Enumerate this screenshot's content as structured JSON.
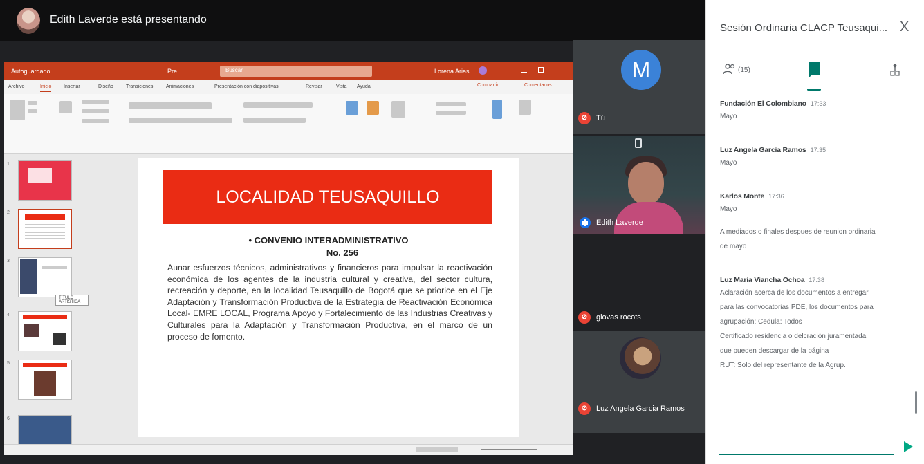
{
  "presenter": {
    "text": "Edith Laverde está presentando"
  },
  "ppt": {
    "autosave": "Autoguardado",
    "filename": "Pre...",
    "search_placeholder": "Buscar",
    "user": "Lorena Arias",
    "tabs": [
      "Archivo",
      "Inicio",
      "Insertar",
      "Diseño",
      "Transiciones",
      "Animaciones",
      "Presentación con diapositivas",
      "Revisar",
      "Vista",
      "Ayuda"
    ],
    "active_tab": "Inicio",
    "share": "Compartir",
    "comments": "Comentarios",
    "tooltip": "TÍTULO ARTÍSTICA",
    "slide": {
      "title": "LOCALIDAD TEUSAQUILLO",
      "subtitle1": "• CONVENIO INTERADMINISTRATIVO",
      "subtitle2": "No. 256",
      "body": "Aunar esfuerzos técnicos, administrativos y financieros para impulsar la reactivación económica de los agentes de la industria cultural y creativa, del sector cultura, recreación y deporte, en la localidad Teusaquillo de Bogotá que se priorice en el Eje Adaptación y Transformación Productiva de la Estrategia de Reactivación Económica Local- EMRE LOCAL, Programa Apoyo y Fortalecimiento de las Industrias Creativas y Culturales para la Adaptación y Transformación Productiva, en el marco de un proceso de fomento."
    },
    "thumb_numbers": [
      "1",
      "2",
      "3",
      "4",
      "5",
      "6"
    ]
  },
  "participants": {
    "me": {
      "initial": "M",
      "name": "Tú"
    },
    "edith": {
      "name": "Edith Laverde"
    },
    "giovas": {
      "name": "giovas rocots"
    },
    "luz": {
      "name": "Luz Angela Garcia Ramos"
    }
  },
  "panel": {
    "title": "Sesión Ordinaria CLACP Teusaqui...",
    "close": "X",
    "people_count": "(15)",
    "messages": [
      {
        "sender": "Fundación El Colombiano",
        "time": "17:33",
        "lines": [
          "Mayo"
        ]
      },
      {
        "sender": "Luz Angela Garcia Ramos",
        "time": "17:35",
        "lines": [
          "Mayo"
        ]
      },
      {
        "sender": "Karlos Monte",
        "time": "17:36",
        "lines": [
          "Mayo",
          "A mediados o finales despues de reunion ordinaria",
          "de mayo"
        ]
      },
      {
        "sender": "Luz Maria Vianchа Ochoa",
        "time": "17:38",
        "lines": [
          "Aclaración acerca de los documentos a entregar",
          "para las convocatorias PDE, los documentos para",
          "agrupación: Cedula: Todos",
          "Certificado residencia o delcración juramentada",
          "que pueden descargar de la página",
          "RUT: Solo del representante de la Agrup."
        ]
      }
    ],
    "input_value": "",
    "input_placeholder": ""
  },
  "colors": {
    "ppt_red": "#c43e1c",
    "slide_banner": "#ea2c14",
    "meet_teal": "#00796b",
    "mute_red": "#ea4335",
    "avatar_blue": "#3b82d8"
  }
}
